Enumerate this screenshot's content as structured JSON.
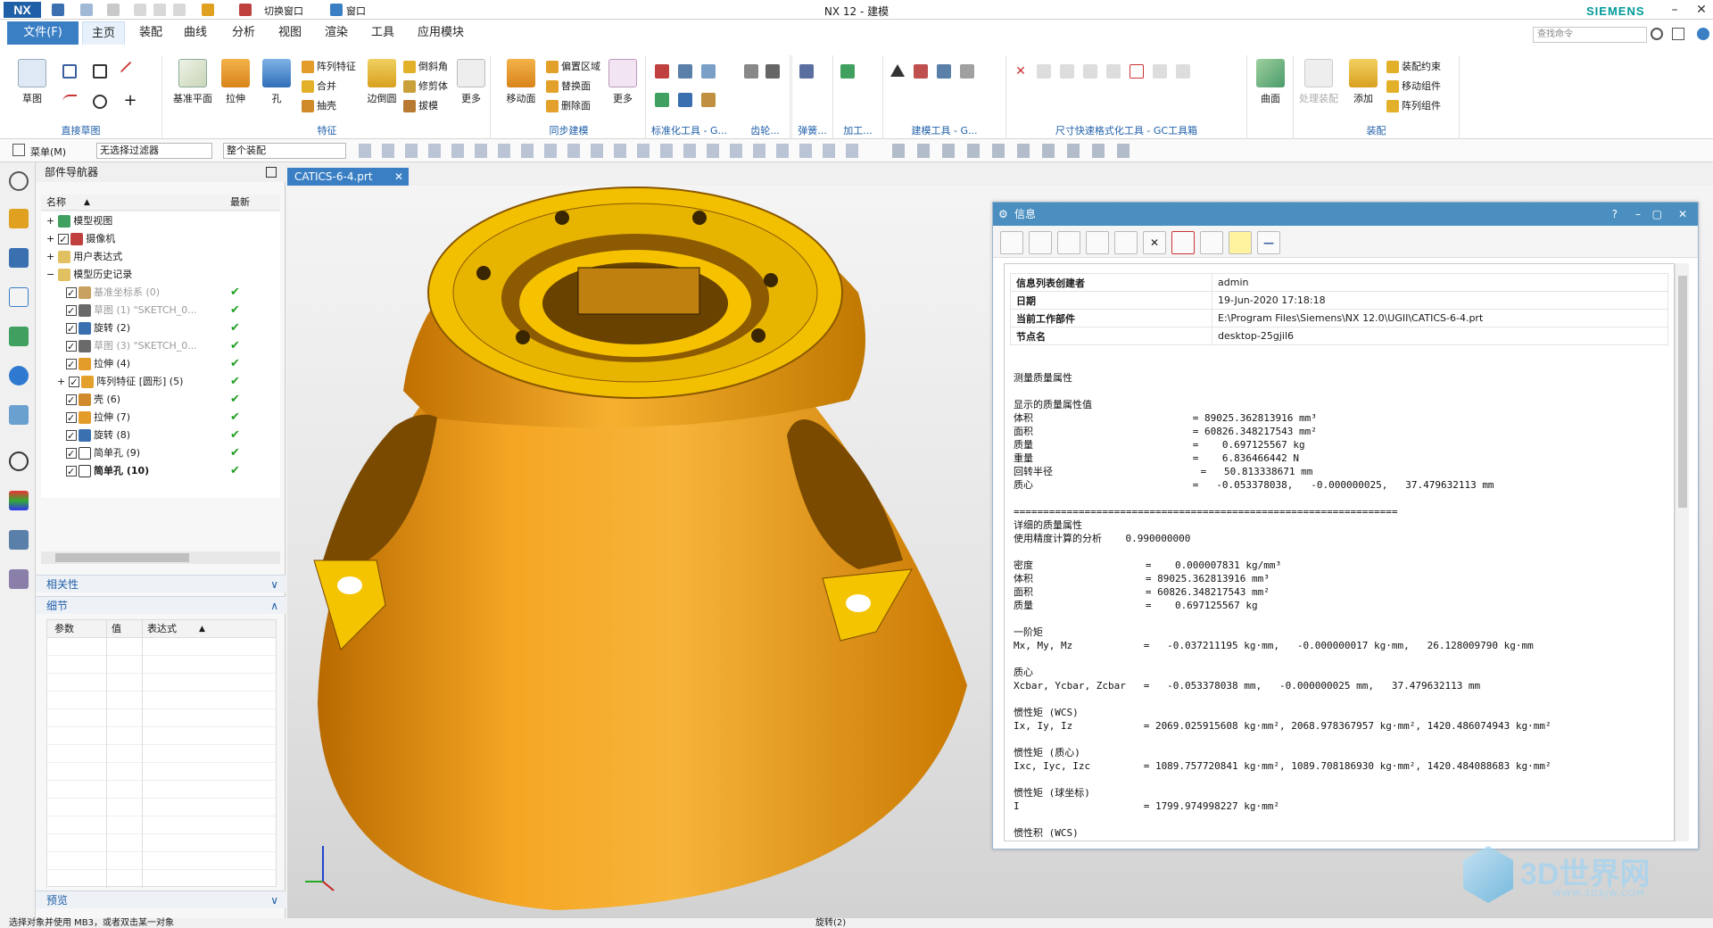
{
  "app": {
    "logo": "NX",
    "title": "NX 12 - 建模",
    "brand": "SIEMENS"
  },
  "quick": {
    "switch_window": "切换窗口",
    "window": "窗口"
  },
  "menu": {
    "file": "文件(F)",
    "tabs": [
      "主页",
      "装配",
      "曲线",
      "分析",
      "视图",
      "渲染",
      "工具",
      "应用模块"
    ],
    "search_placeholder": "查找命令"
  },
  "ribbon": {
    "sketch": "草图",
    "direct_sketch": "直接草图",
    "datum": "基准平面",
    "extrude": "拉伸",
    "hole": "孔",
    "pattern": "阵列特征",
    "unite": "合并",
    "shell": "抽壳",
    "edge_blend": "边倒圆",
    "chamfer": "倒斜角",
    "trim_body": "修剪体",
    "draft": "拔模",
    "more": "更多",
    "feature": "特征",
    "move_face": "移动面",
    "offset_region": "偏置区域",
    "replace_face": "替换面",
    "delete_face": "删除面",
    "sync": "同步建模",
    "std_tools": "标准化工具 - G...",
    "gear": "齿轮...",
    "spring": "弹簧...",
    "machining": "加工...",
    "modeling_tools": "建模工具 - G...",
    "dim_tools": "尺寸快速格式化工具 - GC工具箱",
    "surface": "曲面",
    "process": "处理装配",
    "add": "添加",
    "assembly_constraint": "装配约束",
    "move_component": "移动组件",
    "pattern_component": "阵列组件",
    "assembly": "装配"
  },
  "selbar": {
    "menu": "菜单(M)",
    "filter": "无选择过滤器",
    "scope": "整个装配"
  },
  "navigator": {
    "title": "部件导航器",
    "col_name": "名称",
    "col_latest": "最新",
    "items": [
      {
        "label": "模型视图"
      },
      {
        "label": "摄像机"
      },
      {
        "label": "用户表达式"
      },
      {
        "label": "模型历史记录"
      },
      {
        "label": "基准坐标系 (0)"
      },
      {
        "label": "草图 (1) \"SKETCH_0..."
      },
      {
        "label": "旋转 (2)"
      },
      {
        "label": "草图 (3) \"SKETCH_0..."
      },
      {
        "label": "拉伸 (4)"
      },
      {
        "label": "阵列特征 [圆形] (5)"
      },
      {
        "label": "壳 (6)"
      },
      {
        "label": "拉伸 (7)"
      },
      {
        "label": "旋转 (8)"
      },
      {
        "label": "简单孔 (9)"
      },
      {
        "label": "简单孔 (10)"
      }
    ],
    "dependency": "相关性",
    "details": "细节",
    "detail_cols": [
      "参数",
      "值",
      "表达式"
    ],
    "preview": "预览"
  },
  "graphics": {
    "tab": "CATICS-6-4.prt"
  },
  "info": {
    "title": "信息",
    "rows": [
      {
        "k": "信息列表创建者",
        "v": "admin"
      },
      {
        "k": "日期",
        "v": "19-Jun-2020 17:18:18"
      },
      {
        "k": "当前工作部件",
        "v": "E:\\Program Files\\Siemens\\NX 12.0\\UGII\\CATICS-6-4.prt"
      },
      {
        "k": "节点名",
        "v": "desktop-25gjil6"
      }
    ],
    "body": "测量质量属性\n\n显示的质量属性值\n体积                           = 89025.362813916 mm³\n面积                           = 60826.348217543 mm²\n质量                           =    0.697125567 kg\n重量                           =    6.836466442 N\n回转半径                         =   50.813338671 mm\n质心                           =   -0.053378038,   -0.000000025,   37.479632113 mm\n\n=================================================================\n详细的质量属性\n使用精度计算的分析    0.990000000\n\n密度                   =    0.000007831 kg/mm³\n体积                   = 89025.362813916 mm³\n面积                   = 60826.348217543 mm²\n质量                   =    0.697125567 kg\n\n一阶矩\nMx, My, Mz            =   -0.037211195 kg·mm,   -0.000000017 kg·mm,   26.128009790 kg·mm\n\n质心\nXcbar, Ycbar, Zcbar   =   -0.053378038 mm,   -0.000000025 mm,   37.479632113 mm\n\n惯性矩 (WCS)\nIx, Iy, Iz            = 2069.025915608 kg·mm², 2068.978367957 kg·mm², 1420.486074943 kg·mm²\n\n惯性矩 (质心)\nIxc, Iyc, Izc         = 1089.757720841 kg·mm², 1089.708186930 kg·mm², 1420.484088683 kg·mm²\n\n惯性矩 (球坐标)\nI                     = 1799.974998227 kg·mm²\n\n惯性积 (WCS)"
  },
  "status": {
    "left": "选择对象并使用 MB3，或者双击某一对象",
    "center": "旋转(2)"
  },
  "watermark": {
    "text": "3D世界网",
    "url": "WWW.3DSJW.COM"
  },
  "colors": {
    "accent": "#3a7fc4",
    "part": "#f5a623",
    "ok": "#22a022"
  }
}
